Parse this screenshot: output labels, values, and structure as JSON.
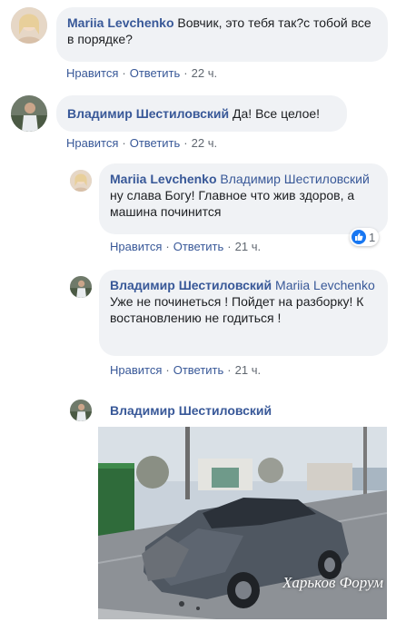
{
  "comments": [
    {
      "author": "Mariia Levchenko",
      "text": "Вовчик, это тебя так?с тобой все в порядке?",
      "like": "Нравится",
      "reply": "Ответить",
      "time": "22 ч."
    },
    {
      "author": "Владимир Шестиловский",
      "text": "Да! Все целое!",
      "like": "Нравится",
      "reply": "Ответить",
      "time": "22 ч."
    }
  ],
  "replies": [
    {
      "author": "Mariia Levchenko",
      "mention": "Владимир Шестиловский",
      "text": "ну слава Богу! Главное что жив здоров, а машина починится",
      "like": "Нравится",
      "reply": "Ответить",
      "time": "21 ч.",
      "reaction_count": "1"
    },
    {
      "author": "Владимир Шестиловский",
      "mention": "Mariia Levchenko",
      "text": "Уже не починеться ! Пойдет на разборку! К востановлению не годиться !",
      "like": "Нравится",
      "reply": "Ответить",
      "time": "21 ч."
    },
    {
      "author": "Владимир Шестиловский",
      "photo_watermark": "Харьков Форум"
    }
  ],
  "icons": {
    "like_reaction": "thumbs-up-icon"
  },
  "colors": {
    "name_link": "#385898",
    "bubble_bg": "#f0f2f5",
    "like_blue": "#1877f2",
    "meta_gray": "#606770"
  }
}
